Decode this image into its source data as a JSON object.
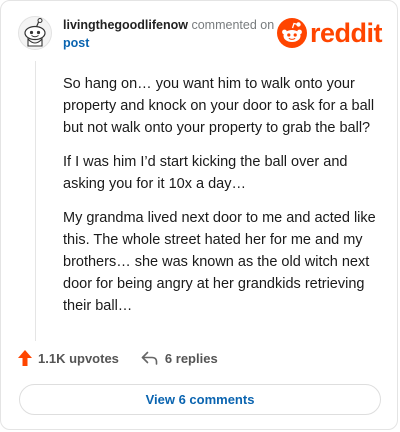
{
  "comment": {
    "username": "livingthegoodlifenow",
    "action_text": "commented on",
    "post_link": "post",
    "paragraphs": [
      "So hang on… you want him to walk onto your property and knock on your door to ask for a ball but not walk onto your property to grab the ball?",
      "If I was him I’d start kicking the ball over and asking you for it 10x a day…",
      "My grandma lived next door to me and acted like this. The whole street hated her for me and my brothers… she was known as the old witch next door for being angry at her grandkids retrieving their ball…"
    ]
  },
  "brand": {
    "name": "reddit",
    "color": "#ff4500",
    "icon": "reddit-snoo-icon"
  },
  "actions": {
    "upvotes_label": "1.1K upvotes",
    "replies_label": "6 replies",
    "upvote_icon": "upvote-arrow-icon",
    "reply_icon": "reply-arrow-icon",
    "upvote_color": "#ff4500"
  },
  "footer": {
    "view_comments_label": "View 6 comments"
  },
  "colors": {
    "link": "#0a64b0",
    "muted": "#787c7e"
  }
}
